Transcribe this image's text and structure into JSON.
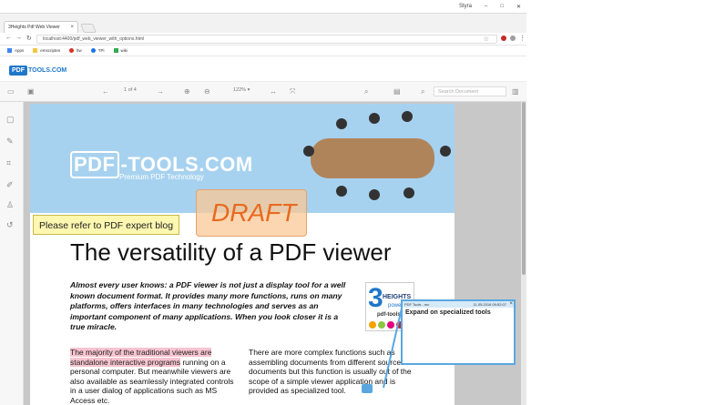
{
  "browser": {
    "tab_title": "3Heights Pdf Web Viewer",
    "tab_close": "×",
    "user_name": "Styra",
    "url": "localhost:4400/pdf_web_viewer_with_options.html",
    "bookmarks": [
      "Apps",
      "emscripten",
      "ltw",
      "TPi",
      "wiki"
    ]
  },
  "app": {
    "logo_box": "PDF",
    "logo_text": "TOOLS.COM"
  },
  "toolbar": {
    "page_indicator": "1 of 4",
    "zoom_level": "122% ▾",
    "search_placeholder": "Search Document"
  },
  "document": {
    "banner_logo_box": "PDF",
    "banner_logo_rest": "-TOOLS.COM",
    "banner_subtitle": "Premium PDF Technology",
    "stamp_text": "DRAFT",
    "note_text": "Please refer to PDF expert blog",
    "heading": "The versatility of a PDF viewer",
    "intro": "Almost every user knows: a PDF viewer is not just a display tool for a well known document format. It provides many more functions, runs on many platforms, offers interfaces in many technologies and serves as an important component of many applications. When you look closer it is a true miracle.",
    "col1_highlight": "The majority of the traditional viewers are standalone interactive programs",
    "col1_rest": " running on a personal computer. But meanwhile viewers are also available as seamlessly integrated controls in a user dialog of applications such as MS Access etc.",
    "col2": "There are more complex functions such as assembling documents from different sources documents but this function is usually out of the scope of a simple viewer application and is provided as specialized tool.",
    "brand_num": "3",
    "brand_heights": "HEIGHTS",
    "brand_powered": "powered",
    "brand_tools": "pdf-tools"
  },
  "popup": {
    "author": "PDF Tools - mc",
    "date": "11.05.2016 09:52:07",
    "close": "×",
    "text": "Expand on specialized tools"
  },
  "colors": {
    "accent": "#1f77c9",
    "banner": "#a7d2ef",
    "stamp": "#e86a1f",
    "highlight": "#f7c4d0",
    "note_bg": "#fdf7b0"
  }
}
